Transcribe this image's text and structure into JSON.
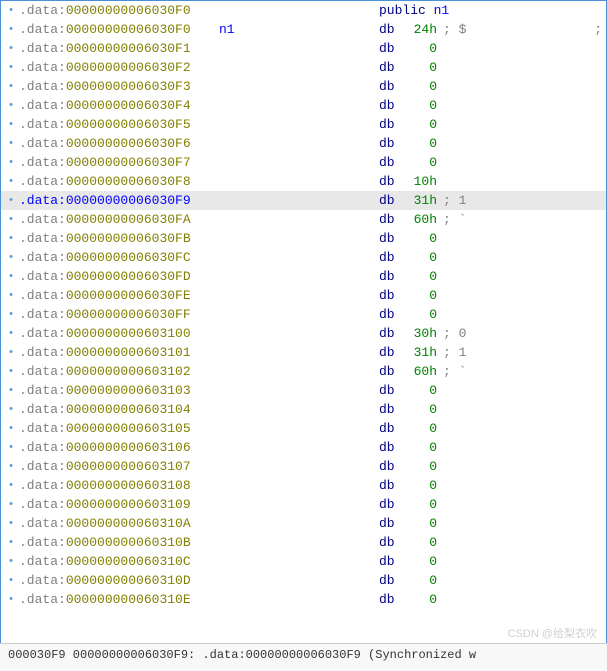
{
  "lines": [
    {
      "bullet": "•",
      "seg": ".data",
      "addr": "00000000006030F0",
      "label": "",
      "op": "public",
      "val": "n1",
      "comment": "",
      "selected": false,
      "isPublic": true,
      "farRight": ""
    },
    {
      "bullet": "•",
      "seg": ".data",
      "addr": "00000000006030F0",
      "label": "n1",
      "op": "db",
      "val": "24h",
      "comment": "; $",
      "selected": false,
      "farRight": ";"
    },
    {
      "bullet": "•",
      "seg": ".data",
      "addr": "00000000006030F1",
      "label": "",
      "op": "db",
      "val": "0",
      "comment": "",
      "selected": false,
      "farRight": ""
    },
    {
      "bullet": "•",
      "seg": ".data",
      "addr": "00000000006030F2",
      "label": "",
      "op": "db",
      "val": "0",
      "comment": "",
      "selected": false,
      "farRight": ""
    },
    {
      "bullet": "•",
      "seg": ".data",
      "addr": "00000000006030F3",
      "label": "",
      "op": "db",
      "val": "0",
      "comment": "",
      "selected": false,
      "farRight": ""
    },
    {
      "bullet": "•",
      "seg": ".data",
      "addr": "00000000006030F4",
      "label": "",
      "op": "db",
      "val": "0",
      "comment": "",
      "selected": false,
      "farRight": ""
    },
    {
      "bullet": "•",
      "seg": ".data",
      "addr": "00000000006030F5",
      "label": "",
      "op": "db",
      "val": "0",
      "comment": "",
      "selected": false,
      "farRight": ""
    },
    {
      "bullet": "•",
      "seg": ".data",
      "addr": "00000000006030F6",
      "label": "",
      "op": "db",
      "val": "0",
      "comment": "",
      "selected": false,
      "farRight": ""
    },
    {
      "bullet": "•",
      "seg": ".data",
      "addr": "00000000006030F7",
      "label": "",
      "op": "db",
      "val": "0",
      "comment": "",
      "selected": false,
      "farRight": ""
    },
    {
      "bullet": "•",
      "seg": ".data",
      "addr": "00000000006030F8",
      "label": "",
      "op": "db",
      "val": "10h",
      "comment": "",
      "selected": false,
      "farRight": ""
    },
    {
      "bullet": "•",
      "seg": ".data",
      "addr": "00000000006030F9",
      "label": "",
      "op": "db",
      "val": "31h",
      "comment": "; 1",
      "selected": true,
      "farRight": ""
    },
    {
      "bullet": "•",
      "seg": ".data",
      "addr": "00000000006030FA",
      "label": "",
      "op": "db",
      "val": "60h",
      "comment": "; `",
      "selected": false,
      "farRight": ""
    },
    {
      "bullet": "•",
      "seg": ".data",
      "addr": "00000000006030FB",
      "label": "",
      "op": "db",
      "val": "0",
      "comment": "",
      "selected": false,
      "farRight": ""
    },
    {
      "bullet": "•",
      "seg": ".data",
      "addr": "00000000006030FC",
      "label": "",
      "op": "db",
      "val": "0",
      "comment": "",
      "selected": false,
      "farRight": ""
    },
    {
      "bullet": "•",
      "seg": ".data",
      "addr": "00000000006030FD",
      "label": "",
      "op": "db",
      "val": "0",
      "comment": "",
      "selected": false,
      "farRight": ""
    },
    {
      "bullet": "•",
      "seg": ".data",
      "addr": "00000000006030FE",
      "label": "",
      "op": "db",
      "val": "0",
      "comment": "",
      "selected": false,
      "farRight": ""
    },
    {
      "bullet": "•",
      "seg": ".data",
      "addr": "00000000006030FF",
      "label": "",
      "op": "db",
      "val": "0",
      "comment": "",
      "selected": false,
      "farRight": ""
    },
    {
      "bullet": "•",
      "seg": ".data",
      "addr": "0000000000603100",
      "label": "",
      "op": "db",
      "val": "30h",
      "comment": "; 0",
      "selected": false,
      "farRight": ""
    },
    {
      "bullet": "•",
      "seg": ".data",
      "addr": "0000000000603101",
      "label": "",
      "op": "db",
      "val": "31h",
      "comment": "; 1",
      "selected": false,
      "farRight": ""
    },
    {
      "bullet": "•",
      "seg": ".data",
      "addr": "0000000000603102",
      "label": "",
      "op": "db",
      "val": "60h",
      "comment": "; `",
      "selected": false,
      "farRight": ""
    },
    {
      "bullet": "•",
      "seg": ".data",
      "addr": "0000000000603103",
      "label": "",
      "op": "db",
      "val": "0",
      "comment": "",
      "selected": false,
      "farRight": ""
    },
    {
      "bullet": "•",
      "seg": ".data",
      "addr": "0000000000603104",
      "label": "",
      "op": "db",
      "val": "0",
      "comment": "",
      "selected": false,
      "farRight": ""
    },
    {
      "bullet": "•",
      "seg": ".data",
      "addr": "0000000000603105",
      "label": "",
      "op": "db",
      "val": "0",
      "comment": "",
      "selected": false,
      "farRight": ""
    },
    {
      "bullet": "•",
      "seg": ".data",
      "addr": "0000000000603106",
      "label": "",
      "op": "db",
      "val": "0",
      "comment": "",
      "selected": false,
      "farRight": ""
    },
    {
      "bullet": "•",
      "seg": ".data",
      "addr": "0000000000603107",
      "label": "",
      "op": "db",
      "val": "0",
      "comment": "",
      "selected": false,
      "farRight": ""
    },
    {
      "bullet": "•",
      "seg": ".data",
      "addr": "0000000000603108",
      "label": "",
      "op": "db",
      "val": "0",
      "comment": "",
      "selected": false,
      "farRight": ""
    },
    {
      "bullet": "•",
      "seg": ".data",
      "addr": "0000000000603109",
      "label": "",
      "op": "db",
      "val": "0",
      "comment": "",
      "selected": false,
      "farRight": ""
    },
    {
      "bullet": "•",
      "seg": ".data",
      "addr": "000000000060310A",
      "label": "",
      "op": "db",
      "val": "0",
      "comment": "",
      "selected": false,
      "farRight": ""
    },
    {
      "bullet": "•",
      "seg": ".data",
      "addr": "000000000060310B",
      "label": "",
      "op": "db",
      "val": "0",
      "comment": "",
      "selected": false,
      "farRight": ""
    },
    {
      "bullet": "•",
      "seg": ".data",
      "addr": "000000000060310C",
      "label": "",
      "op": "db",
      "val": "0",
      "comment": "",
      "selected": false,
      "farRight": ""
    },
    {
      "bullet": "•",
      "seg": ".data",
      "addr": "000000000060310D",
      "label": "",
      "op": "db",
      "val": "0",
      "comment": "",
      "selected": false,
      "farRight": ""
    },
    {
      "bullet": "•",
      "seg": ".data",
      "addr": "000000000060310E",
      "label": "",
      "op": "db",
      "val": "0",
      "comment": "",
      "selected": false,
      "farRight": ""
    }
  ],
  "statusbar": "000030F9 00000000006030F9: .data:00000000006030F9 (Synchronized w",
  "watermark": "CSDN @给梨衣吹",
  "colon": ":"
}
